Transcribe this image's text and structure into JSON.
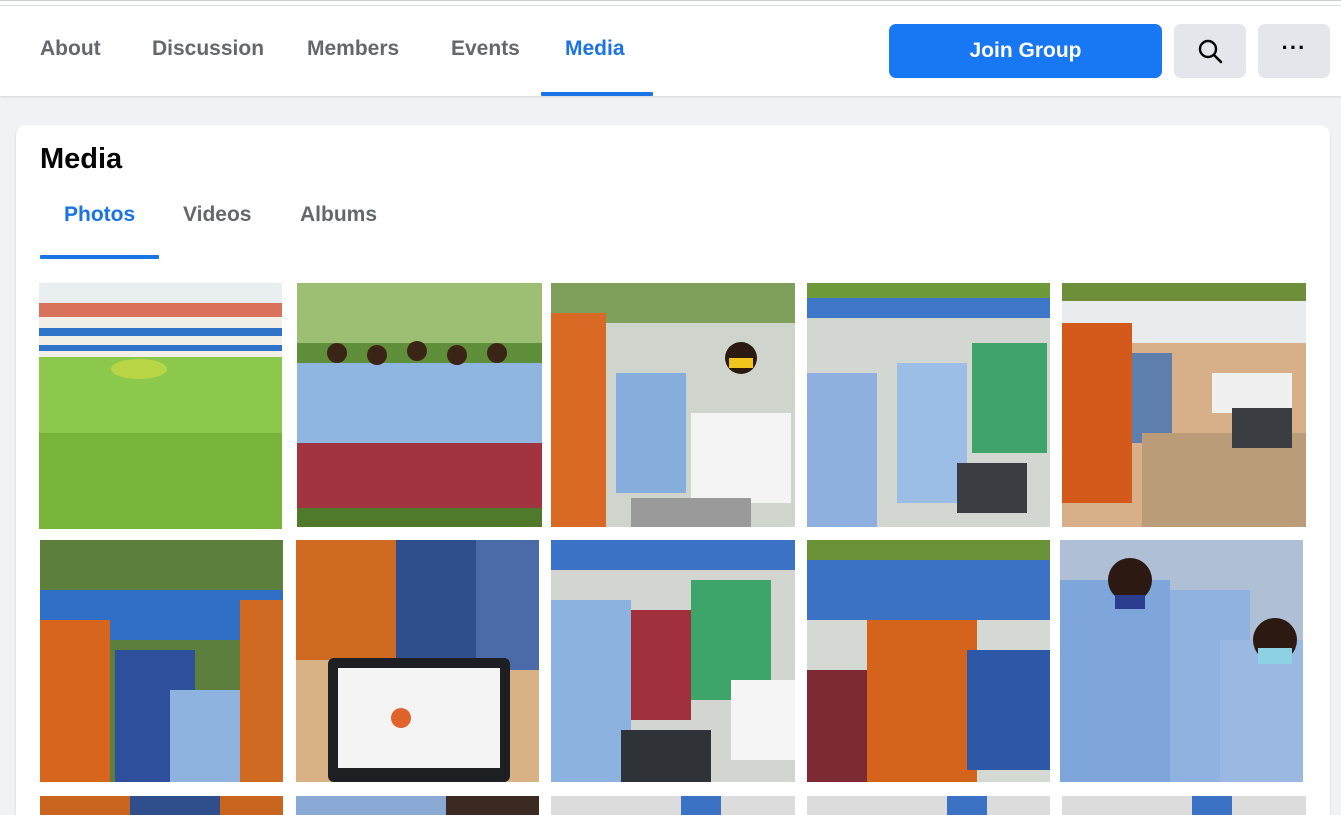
{
  "group_nav": {
    "tabs": [
      {
        "label": "About"
      },
      {
        "label": "Discussion"
      },
      {
        "label": "Members"
      },
      {
        "label": "Events"
      },
      {
        "label": "Media"
      }
    ],
    "active_tab": "Media",
    "join_label": "Join Group",
    "search_icon": "search-icon",
    "more_icon": "more-options-icon",
    "more_label": "···"
  },
  "media": {
    "title": "Media",
    "tabs": [
      {
        "label": "Photos"
      },
      {
        "label": "Videos"
      },
      {
        "label": "Albums"
      }
    ],
    "active_tab": "Photos"
  },
  "colors": {
    "accent": "#1b74e4",
    "join_button": "#1877f2",
    "page_bg": "#f0f2f5",
    "inactive_tab": "#65676b"
  }
}
